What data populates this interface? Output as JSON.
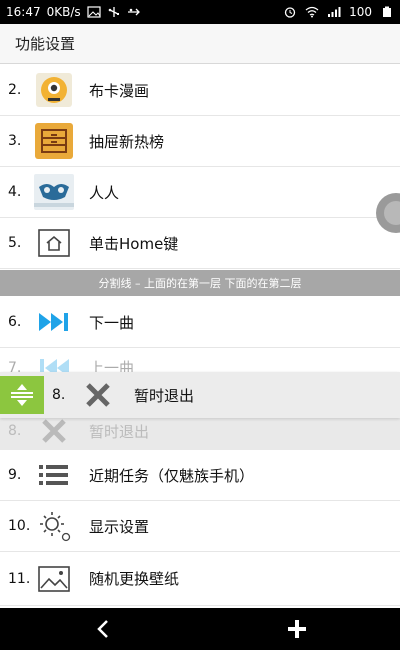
{
  "status_bar": {
    "time": "16:47",
    "speed": "0KB/s",
    "battery": "100",
    "icons": [
      "image-icon",
      "usb-icon",
      "usb-debug-icon",
      "alarm-icon",
      "wifi-icon",
      "signal-icon",
      "battery-icon"
    ]
  },
  "header": {
    "title": "功能设置"
  },
  "list": [
    {
      "num": "2.",
      "label": "布卡漫画",
      "icon": "buka-app-icon"
    },
    {
      "num": "3.",
      "label": "抽屉新热榜",
      "icon": "drawer-app-icon"
    },
    {
      "num": "4.",
      "label": "人人",
      "icon": "renren-app-icon"
    },
    {
      "num": "5.",
      "label": "单击Home键",
      "icon": "home-icon"
    },
    {
      "num": "6.",
      "label": "下一曲",
      "icon": "next-track-icon"
    },
    {
      "num": "7.",
      "label": "上一曲",
      "icon": "previous-track-icon"
    },
    {
      "num": "9.",
      "label": "近期任务（仅魅族手机）",
      "icon": "list-icon"
    },
    {
      "num": "10.",
      "label": "显示设置",
      "icon": "brightness-settings-icon"
    },
    {
      "num": "11.",
      "label": "随机更换壁纸",
      "icon": "wallpaper-icon"
    }
  ],
  "divider": {
    "text": "分割线 – 上面的在第一层 下面的在第二层"
  },
  "dragging_item": {
    "num": "8.",
    "label": "暂时退出",
    "icon": "close-icon"
  },
  "shadow_item": {
    "num": "8.",
    "label": "暂时退出"
  },
  "colors": {
    "accent_green": "#8cc63f",
    "next_track_blue": "#1fa3e8",
    "divider_gray": "#a7a7a7"
  }
}
